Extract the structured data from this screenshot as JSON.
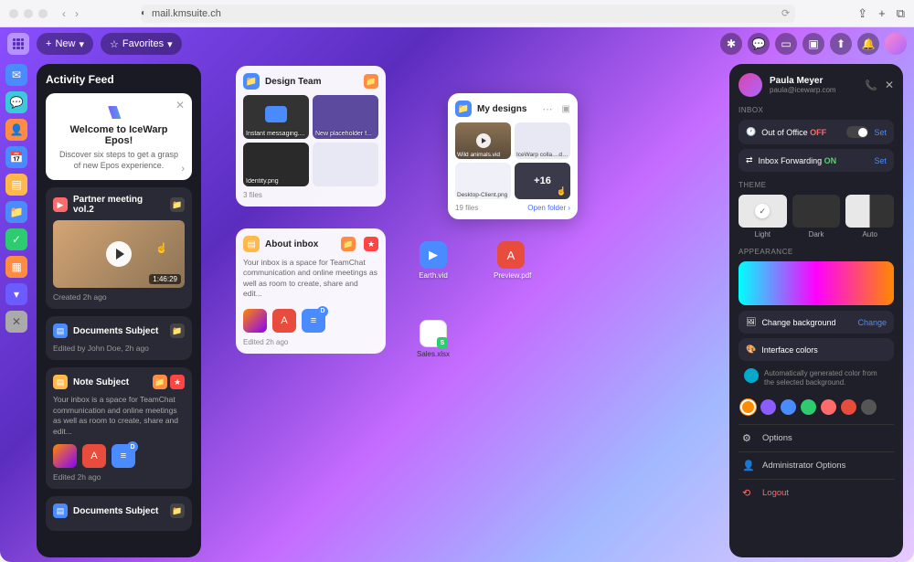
{
  "browser": {
    "url": "mail.kmsuite.ch"
  },
  "topbar": {
    "new_label": "New",
    "fav_label": "Favorites"
  },
  "dock": [
    {
      "color": "#4a8cff"
    },
    {
      "color": "#3bc9db"
    },
    {
      "color": "#ff8c42"
    },
    {
      "color": "#4a8cff"
    },
    {
      "color": "#9b59ff"
    },
    {
      "color": "#ffb84a"
    },
    {
      "color": "#4a8cff"
    },
    {
      "color": "#2ecc71"
    },
    {
      "color": "#ff8c42"
    },
    {
      "color": "#6b5cff"
    },
    {
      "color": "#888"
    }
  ],
  "feed": {
    "title": "Activity Feed",
    "welcome": {
      "title": "Welcome to IceWarp Epos!",
      "subtitle": "Discover six steps to get a grasp of new Epos experience."
    },
    "partner": {
      "title": "Partner meeting vol.2",
      "duration": "1:46:29",
      "meta": "Created 2h ago"
    },
    "doc1": {
      "title": "Documents Subject",
      "meta": "Edited by John Doe, 2h ago"
    },
    "note": {
      "title": "Note Subject",
      "body": "Your inbox is a space for TeamChat communication and online meetings as well as room to create, share and edit...",
      "meta": "Edited 2h ago"
    },
    "doc2": {
      "title": "Documents Subject"
    }
  },
  "design_team": {
    "title": "Design Team",
    "items": [
      "Instant messaging....",
      "New placeholder f...",
      "Identity.png",
      ""
    ],
    "footer": "3 files"
  },
  "about": {
    "title": "About inbox",
    "body": "Your inbox is a space for TeamChat communication and online meetings as well as room to create, share and edit...",
    "meta": "Edited 2h ago"
  },
  "my_designs": {
    "title": "My designs",
    "items": [
      "Wild animals.vid",
      "IceWarp colla....docx",
      "Desktop-Client.png",
      "+16"
    ],
    "count": "19 files",
    "open": "Open folder"
  },
  "desktop": {
    "earth": "Earth.vid",
    "preview": "Preview.pdf",
    "sales": "Sales.xlsx"
  },
  "settings": {
    "name": "Paula Meyer",
    "email": "paula@icewarp.com",
    "inbox_section": "INBOX",
    "ooo": {
      "label": "Out of Office",
      "status": "OFF",
      "action": "Set"
    },
    "fwd": {
      "label": "Inbox Forwarding",
      "status": "ON",
      "action": "Set"
    },
    "theme_section": "THEME",
    "themes": {
      "light": "Light",
      "dark": "Dark",
      "auto": "Auto"
    },
    "appearance_section": "APPEARANCE",
    "bg": {
      "label": "Change background",
      "action": "Change"
    },
    "colors_label": "Interface colors",
    "colors_info": "Automatically generated color from the selected background.",
    "palette": [
      "#ff8c00",
      "#8b5cff",
      "#4a8cff",
      "#2ecc71",
      "#ff6b6b",
      "#e74c3c",
      "#555"
    ],
    "options": "Options",
    "admin": "Administrator Options",
    "logout": "Logout"
  }
}
